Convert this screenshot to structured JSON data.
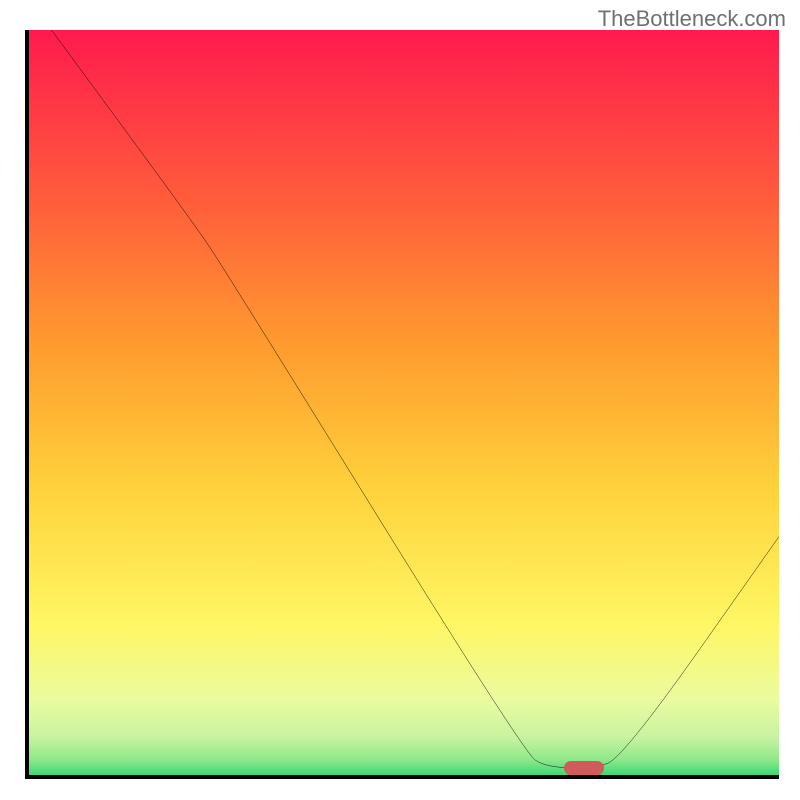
{
  "watermark": "TheBottleneck.com",
  "chart_data": {
    "type": "line",
    "title": "",
    "xlabel": "",
    "ylabel": "",
    "xlim": [
      0,
      100
    ],
    "ylim": [
      0,
      100
    ],
    "gradient_colors": {
      "top": "#ff1a4d",
      "upper_mid": "#ff7a2e",
      "mid": "#ffd33c",
      "lower_mid": "#fff765",
      "near_bottom": "#eafba0",
      "bottom1": "#9de88a",
      "bottom2": "#3dd778"
    },
    "curve": {
      "points": [
        {
          "x": 3,
          "y": 100
        },
        {
          "x": 22,
          "y": 74
        },
        {
          "x": 26,
          "y": 68
        },
        {
          "x": 66,
          "y": 3
        },
        {
          "x": 69,
          "y": 1
        },
        {
          "x": 75,
          "y": 1
        },
        {
          "x": 79,
          "y": 2
        },
        {
          "x": 100,
          "y": 32
        }
      ]
    },
    "marker": {
      "x_percent": 74,
      "y_percent": 99,
      "color": "#d15a5a"
    }
  }
}
